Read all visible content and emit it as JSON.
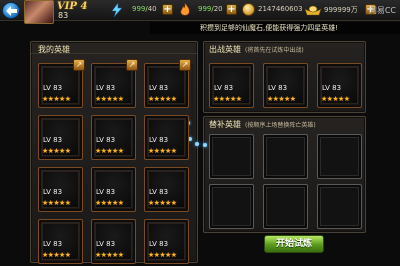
{
  "topbar": {
    "vip_label": "VIP 4",
    "player_level": "83",
    "stamina": {
      "current": "999",
      "max": "/40"
    },
    "energy": {
      "current": "999",
      "max": "/20"
    },
    "copper": "2147460603",
    "gold": "999999万",
    "brand": "网易CC"
  },
  "notice": "积攒到足够的仙魔石,便能获得强力四星英雄!",
  "my_heroes": {
    "title": "我的英雄",
    "cards": [
      {
        "level": "LV 83",
        "stars": "★★★★★",
        "badge": "↗"
      },
      {
        "level": "LV 83",
        "stars": "★★★★★",
        "badge": "↗"
      },
      {
        "level": "LV 83",
        "stars": "★★★★★",
        "badge": "↗"
      },
      {
        "level": "LV 83",
        "stars": "★★★★★"
      },
      {
        "level": "LV 83",
        "stars": "★★★★★"
      },
      {
        "level": "LV 83",
        "stars": "★★★★★"
      },
      {
        "level": "LV 83",
        "stars": "★★★★★"
      },
      {
        "level": "LV 83",
        "stars": "★★★★★"
      },
      {
        "level": "LV 83",
        "stars": "★★★★★"
      },
      {
        "level": "LV 83",
        "stars": "★★★★★"
      },
      {
        "level": "LV 83",
        "stars": "★★★★★"
      },
      {
        "level": "LV 83",
        "stars": "★★★★★"
      }
    ]
  },
  "battle_heroes": {
    "title": "出战英雄",
    "hint": "(将首先在试炼中出战)",
    "cards": [
      {
        "level": "LV 83",
        "stars": "★★★★★"
      },
      {
        "level": "LV 83",
        "stars": "★★★★★"
      },
      {
        "level": "LV 83",
        "stars": "★★★★★"
      }
    ]
  },
  "substitute_heroes": {
    "title": "替补英雄",
    "hint": "(按顺序上场替换阵亡英雄)"
  },
  "start_button": "开始试炼",
  "colors": {
    "star": "#f7b41e",
    "card_border": "#7a4a22",
    "start_button": "#5a9a1c"
  }
}
